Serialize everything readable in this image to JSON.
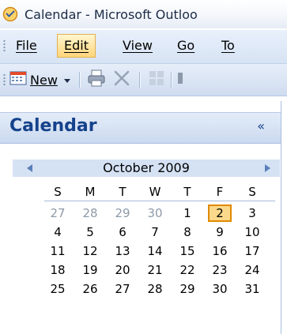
{
  "window": {
    "title": "Calendar - Microsoft Outloo"
  },
  "menu": [
    {
      "label": "File",
      "active": false
    },
    {
      "label": "Edit",
      "active": true
    },
    {
      "label": "View",
      "active": false
    },
    {
      "label": "Go",
      "active": false
    },
    {
      "label": "To",
      "active": false
    }
  ],
  "toolbar": {
    "new_label": "New"
  },
  "nav": {
    "title": "Calendar",
    "collapse_glyph": "«"
  },
  "calendar": {
    "month_label": "October 2009",
    "weekdays": [
      "S",
      "M",
      "T",
      "W",
      "T",
      "F",
      "S"
    ],
    "weeks": [
      [
        {
          "d": "27",
          "other": true
        },
        {
          "d": "28",
          "other": true
        },
        {
          "d": "29",
          "other": true
        },
        {
          "d": "30",
          "other": true
        },
        {
          "d": "1"
        },
        {
          "d": "2",
          "today": true
        },
        {
          "d": "3"
        }
      ],
      [
        {
          "d": "4"
        },
        {
          "d": "5"
        },
        {
          "d": "6"
        },
        {
          "d": "7"
        },
        {
          "d": "8"
        },
        {
          "d": "9"
        },
        {
          "d": "10"
        }
      ],
      [
        {
          "d": "11"
        },
        {
          "d": "12"
        },
        {
          "d": "13"
        },
        {
          "d": "14"
        },
        {
          "d": "15"
        },
        {
          "d": "16"
        },
        {
          "d": "17"
        }
      ],
      [
        {
          "d": "18"
        },
        {
          "d": "19"
        },
        {
          "d": "20"
        },
        {
          "d": "21"
        },
        {
          "d": "22"
        },
        {
          "d": "23"
        },
        {
          "d": "24"
        }
      ],
      [
        {
          "d": "25"
        },
        {
          "d": "26"
        },
        {
          "d": "27"
        },
        {
          "d": "28"
        },
        {
          "d": "29"
        },
        {
          "d": "30"
        },
        {
          "d": "31"
        }
      ]
    ]
  },
  "colors": {
    "accent": "#15428b",
    "today_fill": "#fcd98a",
    "today_border": "#e08a00"
  }
}
